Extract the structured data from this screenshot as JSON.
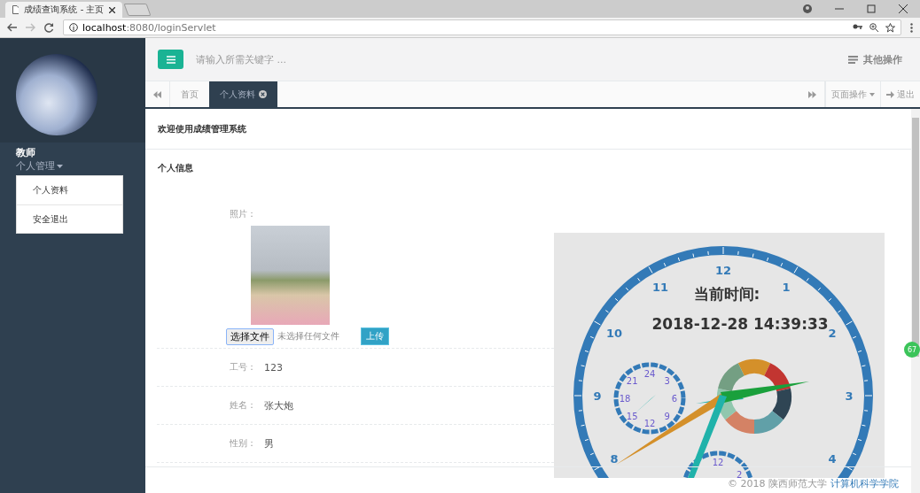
{
  "browser": {
    "tab_title": "成绩查询系统 - 主页",
    "url_host": "localhost",
    "url_path": ":8080/loginServlet"
  },
  "sidebar": {
    "role": "教师",
    "menu_label": "个人管理",
    "menu_expanded": true,
    "menu_items": [
      {
        "label": "个人资料"
      },
      {
        "label": "安全退出"
      }
    ]
  },
  "topbar": {
    "search": {
      "placeholder": "请输入所需关键字 ..."
    },
    "other_actions": "其他操作"
  },
  "page_tabs": [
    {
      "label": "首页",
      "selected": false,
      "closable": false
    },
    {
      "label": "个人资料",
      "selected": true,
      "closable": true
    }
  ],
  "tab_actions": {
    "page_ops": "页面操作",
    "logout": "退出"
  },
  "content": {
    "welcome": "欢迎使用成绩管理系统",
    "section_title": "个人信息",
    "photo_label": "照片：",
    "file": {
      "button": "选择文件",
      "status": "未选择任何文件",
      "upload": "上传"
    },
    "fields": [
      {
        "label": "工号：",
        "value": "123"
      },
      {
        "label": "姓名：",
        "value": "张大炮"
      },
      {
        "label": "性别：",
        "value": "男"
      }
    ]
  },
  "clock": {
    "heading": "当前时间:",
    "datetime": "2018-12-28 14:39:33",
    "numerals": [
      "12",
      "1",
      "2",
      "3",
      "4",
      "8",
      "9",
      "10",
      "11"
    ],
    "hour24_dial": [
      "24",
      "3",
      "6",
      "9",
      "12",
      "15",
      "18",
      "21"
    ],
    "minute_dial": [
      "12",
      "2"
    ],
    "weekdays": [
      {
        "color": "#d4902a"
      },
      {
        "color": "#c23531"
      },
      {
        "color": "#2f4554"
      },
      {
        "color": "#61a0a8"
      },
      {
        "color": "#d48265"
      },
      {
        "color": "#91c7ae"
      },
      {
        "color": "#749f83"
      }
    ]
  },
  "footer": {
    "text": "© 2018 陕西师范大学",
    "link": "计算机科学学院"
  },
  "float_badge": "67"
}
